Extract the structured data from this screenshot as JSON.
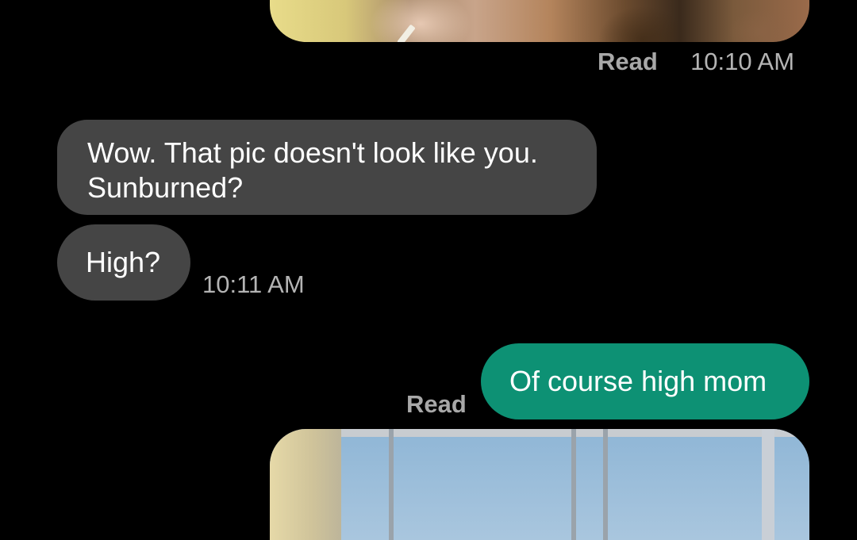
{
  "conversation": {
    "top_image_meta": {
      "read_label": "Read",
      "time": "10:10 AM"
    },
    "incoming": [
      {
        "text_line1": "Wow. That pic doesn't look like you.",
        "text_line2": "Sunburned?"
      },
      {
        "text": "High?",
        "time": "10:11 AM"
      }
    ],
    "outgoing": {
      "text": "Of course high mom",
      "read_label": "Read"
    }
  },
  "colors": {
    "background": "#000000",
    "incoming_bubble": "#454545",
    "outgoing_bubble": "#0d9174",
    "meta_text": "#b4b4b4"
  }
}
